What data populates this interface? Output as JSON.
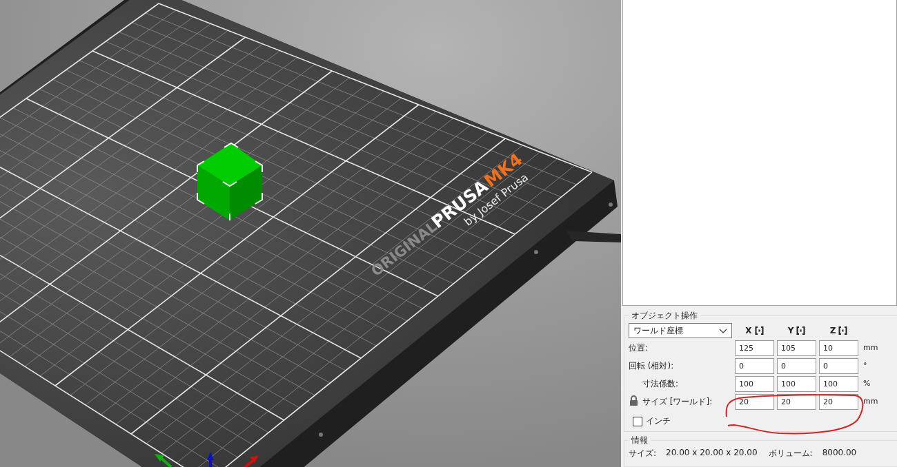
{
  "viewport": {
    "bed_logo": {
      "prefix": "ORIGINAL",
      "brand": "PRUSA",
      "model": "MK4",
      "tagline": "by Josef Prusa"
    }
  },
  "object_manipulation": {
    "title": "オブジェクト操作",
    "coordinate_mode": "ワールド座標",
    "axes": [
      {
        "label": "X"
      },
      {
        "label": "Y"
      },
      {
        "label": "Z"
      }
    ],
    "rows": [
      {
        "label": "位置:",
        "values": [
          "125",
          "105",
          "10"
        ],
        "unit": "mm",
        "kind": "plain"
      },
      {
        "label": "回転 (相対):",
        "values": [
          "0",
          "0",
          "0"
        ],
        "unit": "°",
        "kind": "plain"
      },
      {
        "label": "寸法係数:",
        "values": [
          "100",
          "100",
          "100"
        ],
        "unit": "%",
        "kind": "locked"
      },
      {
        "label": "サイズ [ワールド]:",
        "values": [
          "20",
          "20",
          "20"
        ],
        "unit": "mm",
        "kind": "locked"
      }
    ],
    "inches": {
      "label": "インチ",
      "checked": false
    }
  },
  "info": {
    "title": "情報",
    "size_label": "サイズ:",
    "size_value": "20.00 x 20.00 x 20.00",
    "volume_label": "ボリューム:",
    "volume_value": "8000.00"
  }
}
